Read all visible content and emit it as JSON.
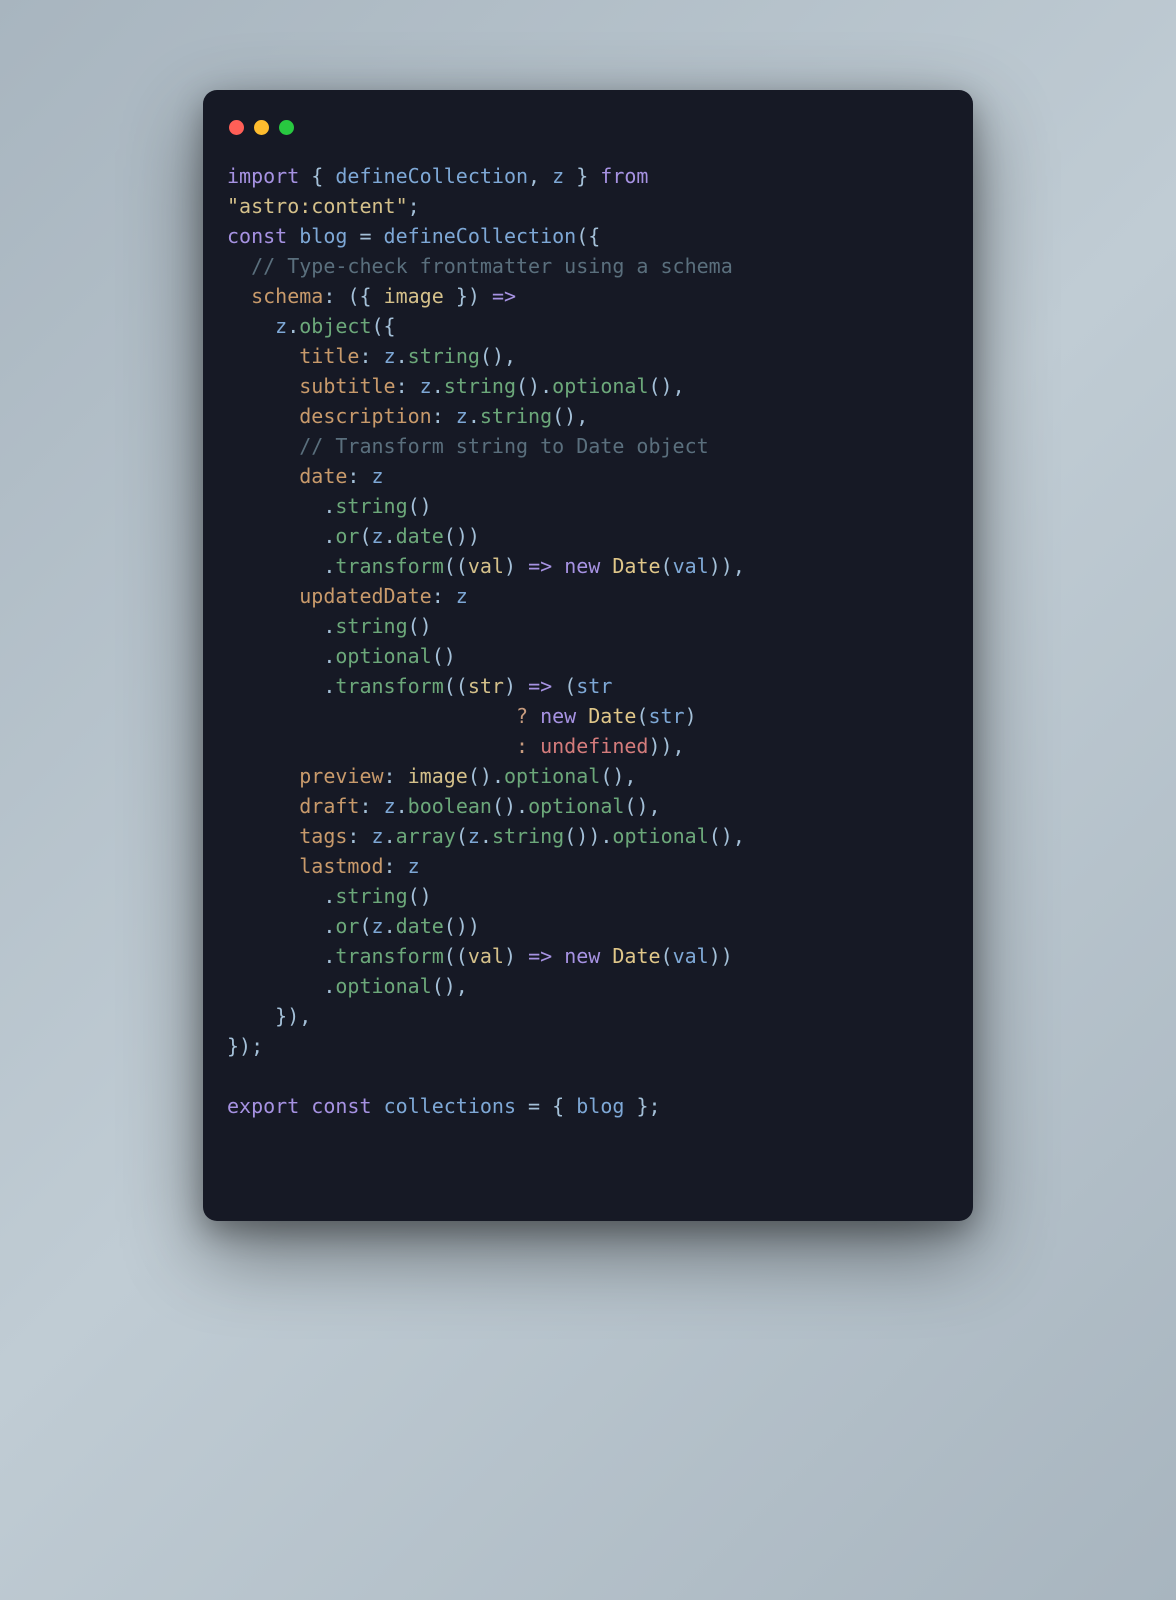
{
  "traffic_lights": {
    "red": "close",
    "yellow": "minimize",
    "green": "zoom"
  },
  "code": {
    "line01": {
      "import_kw": "import",
      "lbrace": " { ",
      "id1": "defineCollection",
      "comma": ", ",
      "id2": "z",
      "rbrace": " } ",
      "from_kw": "from"
    },
    "line02": {
      "str": "\"astro:content\"",
      "semi": ";"
    },
    "line03": {
      "const_kw": "const ",
      "name": "blog",
      "eq": " = ",
      "fn": "defineCollection",
      "open": "({"
    },
    "line04": {
      "indent": "  ",
      "comment": "// Type-check frontmatter using a schema"
    },
    "line05": {
      "indent": "  ",
      "prop": "schema",
      "colon": ": ",
      "open": "({ ",
      "param": "image",
      "close": " }) ",
      "arrow": "=>"
    },
    "line06": {
      "indent": "    ",
      "z": "z",
      "dot": ".",
      "method": "object",
      "open": "({"
    },
    "line07": {
      "indent": "      ",
      "prop": "title",
      "colon": ": ",
      "z": "z",
      "dot": ".",
      "method": "string",
      "paren": "()",
      "comma": ","
    },
    "line08": {
      "indent": "      ",
      "prop": "subtitle",
      "colon": ": ",
      "z": "z",
      "dot1": ".",
      "m1": "string",
      "p1": "()",
      "dot2": ".",
      "m2": "optional",
      "p2": "()",
      "comma": ","
    },
    "line09": {
      "indent": "      ",
      "prop": "description",
      "colon": ": ",
      "z": "z",
      "dot": ".",
      "method": "string",
      "paren": "()",
      "comma": ","
    },
    "line10": {
      "indent": "      ",
      "comment": "// Transform string to Date object"
    },
    "line11": {
      "indent": "      ",
      "prop": "date",
      "colon": ": ",
      "z": "z"
    },
    "line12": {
      "indent": "        ",
      "dot": ".",
      "method": "string",
      "paren": "()"
    },
    "line13": {
      "indent": "        ",
      "dot": ".",
      "method": "or",
      "open": "(",
      "z": "z",
      "dot2": ".",
      "m2": "date",
      "p2": "()",
      "close": ")"
    },
    "line14": {
      "indent": "        ",
      "dot": ".",
      "method": "transform",
      "open": "((",
      "param": "val",
      "mid": ") ",
      "arrow": "=>",
      "sp": " ",
      "new_kw": "new",
      "sp2": " ",
      "cls": "Date",
      "op": "(",
      "arg": "val",
      "cl": "))",
      "comma": ","
    },
    "line15": {
      "indent": "      ",
      "prop": "updatedDate",
      "colon": ": ",
      "z": "z"
    },
    "line16": {
      "indent": "        ",
      "dot": ".",
      "method": "string",
      "paren": "()"
    },
    "line17": {
      "indent": "        ",
      "dot": ".",
      "method": "optional",
      "paren": "()"
    },
    "line18": {
      "indent": "        ",
      "dot": ".",
      "method": "transform",
      "open": "((",
      "param": "str",
      "mid": ") ",
      "arrow": "=>",
      "sp": " (",
      "arg": "str"
    },
    "line19": {
      "indent": "                        ",
      "q": "?",
      "sp": " ",
      "new_kw": "new",
      "sp2": " ",
      "cls": "Date",
      "op": "(",
      "arg": "str",
      "cl": ")"
    },
    "line20": {
      "indent": "                        ",
      "c": ":",
      "sp": " ",
      "undef": "undefined",
      "cl": "))",
      "comma": ","
    },
    "line21": {
      "indent": "      ",
      "prop": "preview",
      "colon": ": ",
      "fn": "image",
      "p1": "()",
      "dot": ".",
      "method": "optional",
      "p2": "()",
      "comma": ","
    },
    "line22": {
      "indent": "      ",
      "prop": "draft",
      "colon": ": ",
      "z": "z",
      "dot1": ".",
      "m1": "boolean",
      "p1": "()",
      "dot2": ".",
      "m2": "optional",
      "p2": "()",
      "comma": ","
    },
    "line23": {
      "indent": "      ",
      "prop": "tags",
      "colon": ": ",
      "z": "z",
      "dot1": ".",
      "m1": "array",
      "op": "(",
      "z2": "z",
      "dot2": ".",
      "m2": "string",
      "p2": "()",
      "cl": ")",
      "dot3": ".",
      "m3": "optional",
      "p3": "()",
      "comma": ","
    },
    "line24": {
      "indent": "      ",
      "prop": "lastmod",
      "colon": ": ",
      "z": "z"
    },
    "line25": {
      "indent": "        ",
      "dot": ".",
      "method": "string",
      "paren": "()"
    },
    "line26": {
      "indent": "        ",
      "dot": ".",
      "method": "or",
      "open": "(",
      "z": "z",
      "dot2": ".",
      "m2": "date",
      "p2": "()",
      "close": ")"
    },
    "line27": {
      "indent": "        ",
      "dot": ".",
      "method": "transform",
      "open": "((",
      "param": "val",
      "mid": ") ",
      "arrow": "=>",
      "sp": " ",
      "new_kw": "new",
      "sp2": " ",
      "cls": "Date",
      "op": "(",
      "arg": "val",
      "cl": "))"
    },
    "line28": {
      "indent": "        ",
      "dot": ".",
      "method": "optional",
      "paren": "()",
      "comma": ","
    },
    "line29": {
      "indent": "    ",
      "close": "}),"
    },
    "line30": {
      "close": "});"
    },
    "line31": {
      "blank": ""
    },
    "line32": {
      "export_kw": "export",
      "sp": " ",
      "const_kw": "const",
      "sp2": " ",
      "name": "collections",
      "eq": " = ",
      "open": "{ ",
      "id": "blog",
      "close": " };"
    }
  }
}
